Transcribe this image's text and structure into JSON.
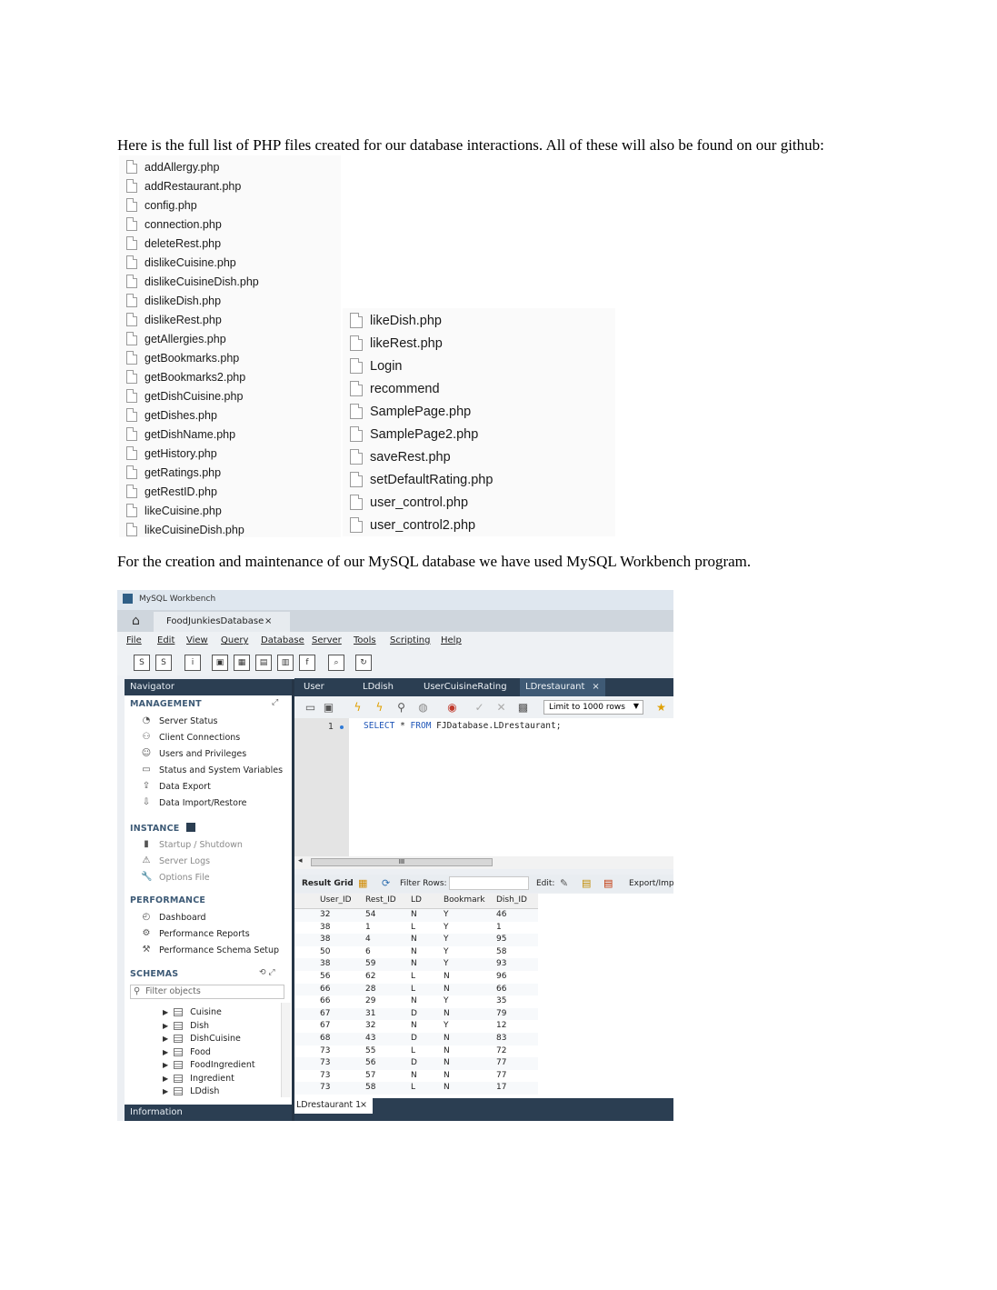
{
  "intro_text": "Here is the full list of PHP files created for our database interactions. All of these will also be found on our github:",
  "file_list_1": [
    "addAllergy.php",
    "addRestaurant.php",
    "config.php",
    "connection.php",
    "deleteRest.php",
    "dislikeCuisine.php",
    "dislikeCuisineDish.php",
    "dislikeDish.php",
    "dislikeRest.php",
    "getAllergies.php",
    "getBookmarks.php",
    "getBookmarks2.php",
    "getDishCuisine.php",
    "getDishes.php",
    "getDishName.php",
    "getHistory.php",
    "getRatings.php",
    "getRestID.php",
    "likeCuisine.php",
    "likeCuisineDish.php"
  ],
  "file_list_2": [
    "likeDish.php",
    "likeRest.php",
    "Login",
    "recommend",
    "SamplePage.php",
    "SamplePage2.php",
    "saveRest.php",
    "setDefaultRating.php",
    "user_control.php",
    "user_control2.php"
  ],
  "mysql_text": "For the creation and maintenance of our MySQL database we have used MySQL Workbench program.",
  "workbench": {
    "window_title": "MySQL Workbench",
    "connection_tab": "FoodJunkiesDatabase",
    "close_glyph": "×",
    "menu": [
      "File",
      "Edit",
      "View",
      "Query",
      "Database",
      "Server",
      "Tools",
      "Scripting",
      "Help"
    ],
    "navigator": {
      "title": "Navigator",
      "management_title": "MANAGEMENT",
      "management_items": [
        "Server Status",
        "Client Connections",
        "Users and Privileges",
        "Status and System Variables",
        "Data Export",
        "Data Import/Restore"
      ],
      "instance_title": "INSTANCE",
      "instance_items": [
        "Startup / Shutdown",
        "Server Logs",
        "Options File"
      ],
      "performance_title": "PERFORMANCE",
      "performance_items": [
        "Dashboard",
        "Performance Reports",
        "Performance Schema Setup"
      ],
      "schemas_title": "SCHEMAS",
      "filter_placeholder": "Filter objects",
      "schema_tables": [
        "Cuisine",
        "Dish",
        "DishCuisine",
        "Food",
        "FoodIngredient",
        "Ingredient",
        "LDdish"
      ],
      "info_title": "Information"
    },
    "editor_tabs": [
      "User",
      "LDdish",
      "UserCuisineRating",
      "LDrestaurant"
    ],
    "active_tab": "LDrestaurant",
    "limit_label": "Limit to 1000 rows",
    "sql": {
      "line_number": "1",
      "keyword_select": "SELECT",
      "star": "*",
      "keyword_from": "FROM",
      "target": "FJDatabase.LDrestaurant;"
    },
    "scroll_marker": "III",
    "result_bar": {
      "result_grid": "Result Grid",
      "filter_rows": "Filter Rows:",
      "edit": "Edit:",
      "export": "Export/Imp"
    },
    "columns": [
      "User_ID",
      "Rest_ID",
      "LD",
      "Bookmark",
      "Dish_ID"
    ],
    "rows": [
      [
        "32",
        "54",
        "N",
        "Y",
        "46"
      ],
      [
        "38",
        "1",
        "L",
        "Y",
        "1"
      ],
      [
        "38",
        "4",
        "N",
        "Y",
        "95"
      ],
      [
        "50",
        "6",
        "N",
        "Y",
        "58"
      ],
      [
        "38",
        "59",
        "N",
        "Y",
        "93"
      ],
      [
        "56",
        "62",
        "L",
        "N",
        "96"
      ],
      [
        "66",
        "28",
        "L",
        "N",
        "66"
      ],
      [
        "66",
        "29",
        "N",
        "Y",
        "35"
      ],
      [
        "67",
        "31",
        "D",
        "N",
        "79"
      ],
      [
        "67",
        "32",
        "N",
        "Y",
        "12"
      ],
      [
        "68",
        "43",
        "D",
        "N",
        "83"
      ],
      [
        "73",
        "55",
        "L",
        "N",
        "72"
      ],
      [
        "73",
        "56",
        "D",
        "N",
        "77"
      ],
      [
        "73",
        "57",
        "N",
        "N",
        "77"
      ],
      [
        "73",
        "58",
        "L",
        "N",
        "17"
      ]
    ],
    "result_tab": "LDrestaurant 1"
  }
}
